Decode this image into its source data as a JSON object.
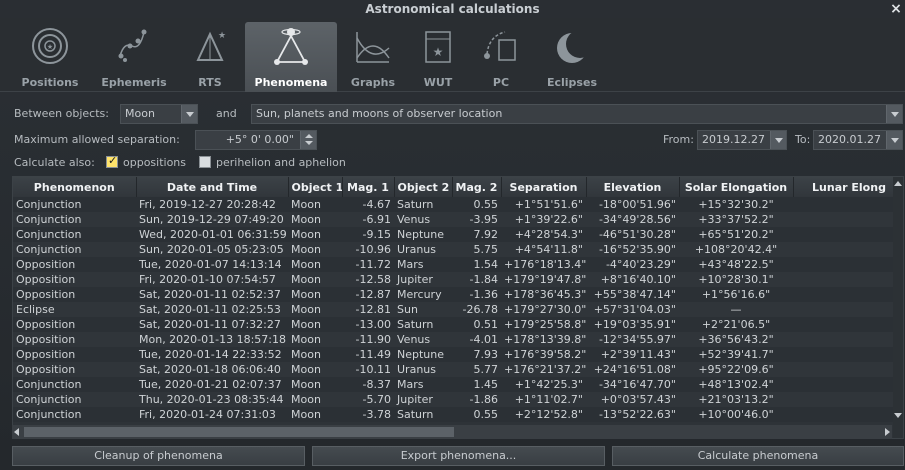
{
  "window": {
    "title": "Astronomical calculations",
    "close_glyph": "×"
  },
  "tabs": [
    {
      "label": "Positions",
      "icon": "positions-icon"
    },
    {
      "label": "Ephemeris",
      "icon": "ephemeris-icon"
    },
    {
      "label": "RTS",
      "icon": "rts-icon"
    },
    {
      "label": "Phenomena",
      "icon": "phenomena-icon",
      "active": true
    },
    {
      "label": "Graphs",
      "icon": "graphs-icon"
    },
    {
      "label": "WUT",
      "icon": "wut-icon"
    },
    {
      "label": "PC",
      "icon": "pc-icon"
    },
    {
      "label": "Eclipses",
      "icon": "eclipses-icon"
    }
  ],
  "controls": {
    "between_label": "Between objects:",
    "object1": "Moon",
    "and_label": "and",
    "object2": "Sun, planets and moons of observer location",
    "max_sep_label": "Maximum allowed separation:",
    "max_sep_value": "+5° 0' 0.00\"",
    "from_label": "From:",
    "from_value": "2019.12.27",
    "to_label": "To:",
    "to_value": "2020.01.27",
    "calc_also_label": "Calculate also:",
    "oppositions_label": "oppositions",
    "oppositions_checked": true,
    "perihelion_label": "perihelion and aphelion",
    "perihelion_checked": false
  },
  "table": {
    "columns": [
      "Phenomenon",
      "Date and Time",
      "Object 1",
      "Mag. 1",
      "Object 2",
      "Mag. 2",
      "Separation",
      "Elevation",
      "Solar Elongation",
      "Lunar Elong"
    ],
    "rows": [
      [
        "Conjunction",
        "Fri, 2019-12-27 20:28:42",
        "Moon",
        "-4.67",
        "Saturn",
        "0.55",
        "+1°51'51.6\"",
        "-18°00'51.96\"",
        "+15°32'30.2\"",
        ""
      ],
      [
        "Conjunction",
        "Sun, 2019-12-29 07:49:20",
        "Moon",
        "-6.91",
        "Venus",
        "-3.95",
        "+1°39'22.6\"",
        "-34°49'28.56\"",
        "+33°37'52.2\"",
        ""
      ],
      [
        "Conjunction",
        "Wed, 2020-01-01 06:31:59",
        "Moon",
        "-9.15",
        "Neptune",
        "7.92",
        "+4°28'54.3\"",
        "-46°51'30.28\"",
        "+65°51'20.2\"",
        ""
      ],
      [
        "Conjunction",
        "Sun, 2020-01-05 05:23:05",
        "Moon",
        "-10.96",
        "Uranus",
        "5.75",
        "+4°54'11.8\"",
        "-16°52'35.90\"",
        "+108°20'42.4\"",
        ""
      ],
      [
        "Opposition",
        "Tue, 2020-01-07 14:13:14",
        "Moon",
        "-11.72",
        "Mars",
        "1.54",
        "+176°18'13.4\"",
        "-4°40'23.29\"",
        "+43°48'22.5\"",
        ""
      ],
      [
        "Opposition",
        "Fri, 2020-01-10 07:54:57",
        "Moon",
        "-12.58",
        "Jupiter",
        "-1.84",
        "+179°19'47.8\"",
        "+8°16'40.10\"",
        "+10°28'30.1\"",
        ""
      ],
      [
        "Opposition",
        "Sat, 2020-01-11 02:52:37",
        "Moon",
        "-12.87",
        "Mercury",
        "-1.36",
        "+178°36'45.3\"",
        "+55°38'47.14\"",
        "+1°56'16.6\"",
        ""
      ],
      [
        "Eclipse",
        "Sat, 2020-01-11 02:25:53",
        "Moon",
        "-12.81",
        "Sun",
        "-26.78",
        "+179°27'30.0\"",
        "+57°31'04.03\"",
        "—",
        ""
      ],
      [
        "Opposition",
        "Sat, 2020-01-11 07:32:27",
        "Moon",
        "-13.00",
        "Saturn",
        "0.51",
        "+179°25'58.8\"",
        "+19°03'35.91\"",
        "+2°21'06.5\"",
        ""
      ],
      [
        "Opposition",
        "Mon, 2020-01-13 18:57:18",
        "Moon",
        "-11.90",
        "Venus",
        "-4.01",
        "+178°13'39.8\"",
        "-12°34'55.97\"",
        "+36°56'43.2\"",
        ""
      ],
      [
        "Opposition",
        "Tue, 2020-01-14 22:33:52",
        "Moon",
        "-11.49",
        "Neptune",
        "7.93",
        "+176°39'58.2\"",
        "+2°39'11.43\"",
        "+52°39'41.7\"",
        ""
      ],
      [
        "Opposition",
        "Sat, 2020-01-18 06:06:40",
        "Moon",
        "-10.11",
        "Uranus",
        "5.77",
        "+176°21'37.2\"",
        "+24°16'51.08\"",
        "+95°22'09.6\"",
        ""
      ],
      [
        "Conjunction",
        "Tue, 2020-01-21 02:07:37",
        "Moon",
        "-8.37",
        "Mars",
        "1.45",
        "+1°42'25.3\"",
        "-34°16'47.70\"",
        "+48°13'02.4\"",
        ""
      ],
      [
        "Conjunction",
        "Thu, 2020-01-23 08:35:44",
        "Moon",
        "-5.70",
        "Jupiter",
        "-1.86",
        "+1°11'02.7\"",
        "+0°03'57.43\"",
        "+21°03'13.2\"",
        ""
      ],
      [
        "Conjunction",
        "Fri, 2020-01-24 07:31:03",
        "Moon",
        "-3.78",
        "Saturn",
        "0.55",
        "+2°12'52.8\"",
        "-13°52'22.63\"",
        "+10°00'46.0\"",
        ""
      ]
    ]
  },
  "buttons": {
    "cleanup": "Cleanup of phenomena",
    "export": "Export phenomena...",
    "calculate": "Calculate phenomena"
  }
}
